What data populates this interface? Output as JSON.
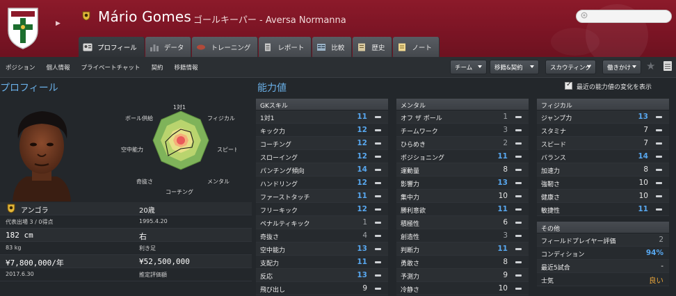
{
  "header": {
    "player_name": "Mário Gomes",
    "subtitle": "ゴールキーパー - Aversa Normanna",
    "crest_text": "Aversa Normanna"
  },
  "tabs": [
    {
      "label": "プロフィール",
      "icon": "profile-card-icon",
      "active": true
    },
    {
      "label": "データ",
      "icon": "bar-chart-icon"
    },
    {
      "label": "トレーニング",
      "icon": "rugby-ball-icon"
    },
    {
      "label": "レポート",
      "icon": "document-icon"
    },
    {
      "label": "比較",
      "icon": "compare-icon"
    },
    {
      "label": "歴史",
      "icon": "history-book-icon"
    },
    {
      "label": "ノート",
      "icon": "notepad-icon"
    }
  ],
  "subnav": {
    "links": [
      "ポジション",
      "個人情報",
      "プライベートチャット",
      "契約",
      "移籍情報"
    ],
    "dropdowns": [
      "チーム",
      "移籍&契約",
      "スカウティング",
      "働きかけ"
    ]
  },
  "profile": {
    "title": "プロフィール",
    "radar_labels": [
      "1対1",
      "フィジカル",
      "スピード",
      "メンタル",
      "コーチング",
      "奇抜さ",
      "空中能力",
      "ボール供給"
    ],
    "nationality": "アンゴラ",
    "age": "20歳",
    "caps": "代表出場 3 / 0得点",
    "birth_date": "1995.4.20",
    "height": "182 cm",
    "foot": "右",
    "weight": "83 kg",
    "foot_label": "利き足",
    "wage": "¥7,800,000/年",
    "value": "¥52,500,000",
    "contract_end": "2017.6.30",
    "value_label": "推定評価額"
  },
  "abilities": {
    "title": "能力値",
    "recent_change_label": "最近の能力値の変化を表示",
    "recent_change_checked": true,
    "gk": {
      "header": "GKスキル",
      "rows": [
        {
          "name": "1対1",
          "value": "11"
        },
        {
          "name": "キック力",
          "value": "12"
        },
        {
          "name": "コーチング",
          "value": "12"
        },
        {
          "name": "スローイング",
          "value": "12"
        },
        {
          "name": "パンチング傾向",
          "value": "14"
        },
        {
          "name": "ハンドリング",
          "value": "12"
        },
        {
          "name": "ファーストタッチ",
          "value": "11"
        },
        {
          "name": "フリーキック",
          "value": "12"
        },
        {
          "name": "ペナルティキック",
          "value": "1"
        },
        {
          "name": "奇抜さ",
          "value": "4"
        },
        {
          "name": "空中能力",
          "value": "13"
        },
        {
          "name": "支配力",
          "value": "11"
        },
        {
          "name": "反応",
          "value": "13"
        },
        {
          "name": "飛び出し",
          "value": "9"
        }
      ]
    },
    "mental": {
      "header": "メンタル",
      "rows": [
        {
          "name": "オフ ザ ボール",
          "value": "1"
        },
        {
          "name": "チームワーク",
          "value": "3"
        },
        {
          "name": "ひらめき",
          "value": "2"
        },
        {
          "name": "ポジショニング",
          "value": "11"
        },
        {
          "name": "運動量",
          "value": "8"
        },
        {
          "name": "影響力",
          "value": "13"
        },
        {
          "name": "集中力",
          "value": "10"
        },
        {
          "name": "勝利意欲",
          "value": "11"
        },
        {
          "name": "積極性",
          "value": "6"
        },
        {
          "name": "創造性",
          "value": "3"
        },
        {
          "name": "判断力",
          "value": "11"
        },
        {
          "name": "勇敢さ",
          "value": "8"
        },
        {
          "name": "予測力",
          "value": "9"
        },
        {
          "name": "冷静さ",
          "value": "10"
        }
      ]
    },
    "physical": {
      "header": "フィジカル",
      "rows": [
        {
          "name": "ジャンプ力",
          "value": "13"
        },
        {
          "name": "スタミナ",
          "value": "7"
        },
        {
          "name": "スピード",
          "value": "7"
        },
        {
          "name": "バランス",
          "value": "14"
        },
        {
          "name": "加速力",
          "value": "8"
        },
        {
          "name": "強靭さ",
          "value": "10"
        },
        {
          "name": "健康さ",
          "value": "10"
        },
        {
          "name": "敏捷性",
          "value": "11"
        }
      ]
    },
    "other": {
      "header": "その他",
      "rows": [
        {
          "name": "フィールドプレイヤー評価",
          "value": "2"
        },
        {
          "name": "コンディション",
          "value": "94%"
        },
        {
          "name": "最近5試合",
          "value": "-"
        },
        {
          "name": "士気",
          "value": "良い"
        }
      ]
    }
  }
}
